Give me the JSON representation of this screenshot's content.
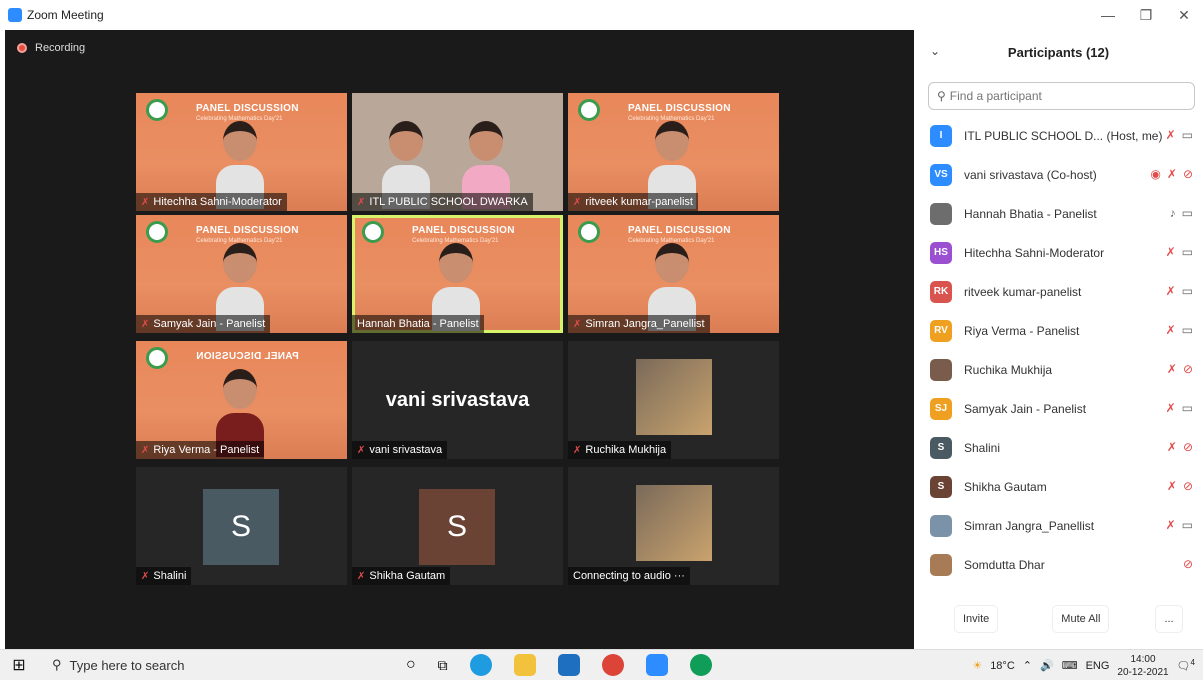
{
  "window": {
    "title": "Zoom Meeting",
    "minimize": "—",
    "restore": "❐",
    "close": "✕"
  },
  "meeting": {
    "recording_label": "Recording",
    "tiles": [
      {
        "name": "Hitechha Sahni-Moderator",
        "type": "panel",
        "muted": true
      },
      {
        "name": "ITL PUBLIC SCHOOL DWARKA",
        "type": "camera",
        "muted": true
      },
      {
        "name": "ritveek kumar-panelist",
        "type": "panel",
        "muted": true
      },
      {
        "name": "Samyak Jain - Panelist",
        "type": "panel",
        "muted": true
      },
      {
        "name": "Hannah Bhatia - Panelist",
        "type": "panel",
        "muted": false,
        "active": true
      },
      {
        "name": "Simran Jangra_Panellist",
        "type": "panel",
        "muted": true
      },
      {
        "name": "Riya Verma - Panelist",
        "type": "panel-mirror",
        "muted": true
      },
      {
        "name": "vani srivastava",
        "type": "name-only",
        "muted": true,
        "big_label": "vani srivastava"
      },
      {
        "name": "Ruchika Mukhija",
        "type": "photo",
        "muted": true
      },
      {
        "name": "Shalini",
        "type": "letter",
        "muted": true,
        "letter": "S",
        "color": "#4a5a63"
      },
      {
        "name": "Shikha Gautam",
        "type": "letter",
        "muted": true,
        "letter": "S",
        "color": "#6b4335"
      },
      {
        "name": "Connecting to audio ···",
        "type": "photo",
        "muted": false
      }
    ],
    "panel_title": "PANEL DISCUSSION",
    "panel_sub": "Celebrating Mathematics Day'21",
    "mirror_title": "PANEL DISCUSSION"
  },
  "participants": {
    "title": "Participants (12)",
    "search_placeholder": "Find a participant",
    "list": [
      {
        "initials": "I",
        "color": "#2d8cff",
        "name": "ITL PUBLIC SCHOOL D...  (Host, me)",
        "mic": "muted",
        "cam": "on"
      },
      {
        "initials": "VS",
        "color": "#2d8cff",
        "name": "vani srivastava (Co-host)",
        "mic": "muted",
        "cam": "off",
        "rec": true
      },
      {
        "initials": "",
        "color": "#6d6d6d",
        "name": "Hannah Bhatia - Panelist",
        "mic": "on",
        "cam": "on"
      },
      {
        "initials": "HS",
        "color": "#9b4fd1",
        "name": "Hitechha Sahni-Moderator",
        "mic": "muted",
        "cam": "on"
      },
      {
        "initials": "RK",
        "color": "#d9534f",
        "name": "ritveek kumar-panelist",
        "mic": "muted",
        "cam": "on"
      },
      {
        "initials": "RV",
        "color": "#f0a020",
        "name": "Riya Verma - Panelist",
        "mic": "muted",
        "cam": "on"
      },
      {
        "initials": "",
        "color": "#7a5c4c",
        "name": "Ruchika Mukhija",
        "mic": "muted",
        "cam": "off"
      },
      {
        "initials": "SJ",
        "color": "#f0a020",
        "name": "Samyak Jain - Panelist",
        "mic": "muted",
        "cam": "on"
      },
      {
        "initials": "S",
        "color": "#4a5a63",
        "name": "Shalini",
        "mic": "muted",
        "cam": "off"
      },
      {
        "initials": "S",
        "color": "#6b4335",
        "name": "Shikha Gautam",
        "mic": "muted",
        "cam": "off"
      },
      {
        "initials": "",
        "color": "#7a93a8",
        "name": "Simran Jangra_Panellist",
        "mic": "muted",
        "cam": "on"
      },
      {
        "initials": "",
        "color": "#a77b55",
        "name": "Somdutta Dhar",
        "mic": "none",
        "cam": "off"
      }
    ],
    "invite_label": "Invite",
    "mute_all_label": "Mute All",
    "more_label": "..."
  },
  "taskbar": {
    "search_placeholder": "Type here to search",
    "temperature": "18°C",
    "language": "ENG",
    "time": "14:00",
    "date": "20-12-2021",
    "notifications": "4"
  }
}
